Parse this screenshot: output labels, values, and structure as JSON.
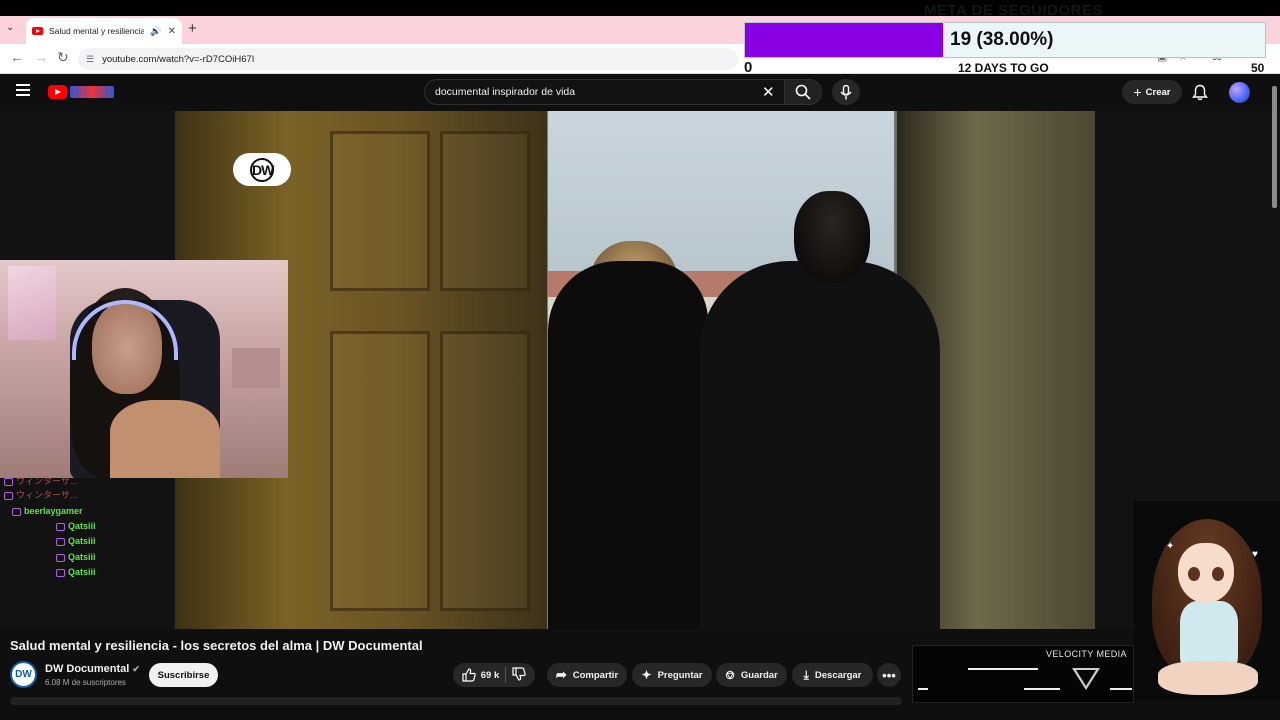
{
  "browser": {
    "tab_title": "Salud mental y resiliencia -",
    "url": "youtube.com/watch?v=-rD7COiH67I"
  },
  "overlay_goal": {
    "heading": "META DE SEGUIDORES",
    "progress_text": "19 (38.00%)",
    "progress_fraction": 0.38,
    "min_label": "0",
    "days_left": "12 DAYS TO GO",
    "max_label": "50",
    "accent_color": "#8a00e6"
  },
  "youtube": {
    "search_value": "documental inspirador de vida",
    "create_label": "Crear",
    "video_watermark": "DW",
    "video_title": "Salud mental y resiliencia - los secretos del alma | DW Documental",
    "channel_name": "DW Documental",
    "channel_avatar_text": "DW",
    "subscribers": "6.08 M de suscriptores",
    "subscribe_label": "Suscribirse",
    "likes": "69 k",
    "share_label": "Compartir",
    "ask_label": "Preguntar",
    "save_label": "Guardar",
    "download_label": "Descargar",
    "brand_color": "#ff0000"
  },
  "chat": {
    "messages": [
      {
        "name": "ウィンターサ...",
        "text": ""
      },
      {
        "name": "ウィンターサ...",
        "text": ""
      },
      {
        "name": "beerlaygamer",
        "text": ""
      },
      {
        "name": "Qatsiii",
        "text": ""
      },
      {
        "name": "Qatsiii",
        "text": ""
      },
      {
        "name": "Qatsiii",
        "text": ""
      },
      {
        "name": "Qatsiii",
        "text": ""
      }
    ]
  },
  "velocity_media": {
    "label": "VELOCITY MEDIA"
  }
}
